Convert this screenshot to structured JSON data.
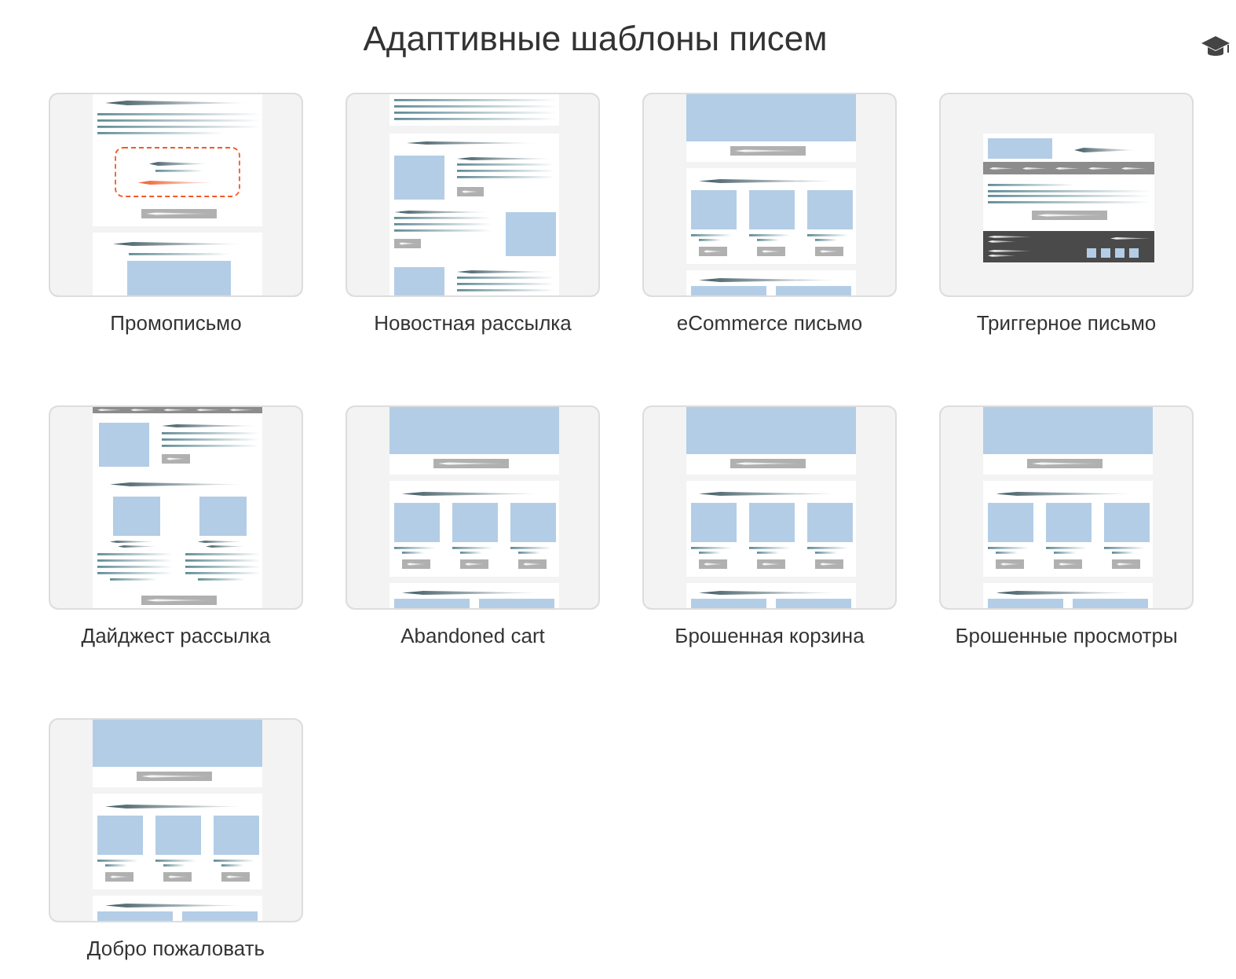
{
  "title": "Адаптивные шаблоны писем",
  "templates": [
    {
      "label": "Промописьмо",
      "kind": "promo"
    },
    {
      "label": "Новостная рассылка",
      "kind": "newsletter"
    },
    {
      "label": "eCommerce письмо",
      "kind": "ecommerce"
    },
    {
      "label": "Триггерное письмо",
      "kind": "trigger"
    },
    {
      "label": "Дайджест рассылка",
      "kind": "digest"
    },
    {
      "label": "Abandoned cart",
      "kind": "ecommerce"
    },
    {
      "label": "Брошенная корзина",
      "kind": "ecommerce"
    },
    {
      "label": "Брошенные просмотры",
      "kind": "ecommerce"
    },
    {
      "label": "Добро пожаловать",
      "kind": "ecommerce"
    }
  ]
}
